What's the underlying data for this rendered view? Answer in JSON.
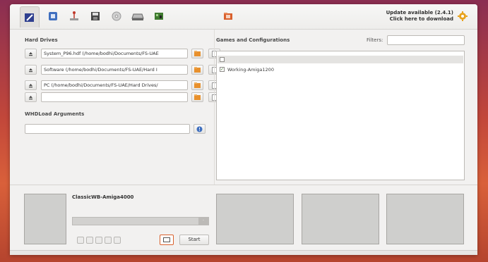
{
  "toolbar": {
    "icons": [
      {
        "name": "config-icon",
        "color": "#2f3f8f"
      },
      {
        "name": "chip-icon",
        "color": "#3f6fbf"
      },
      {
        "name": "joystick-icon",
        "color": "#c0392b"
      },
      {
        "name": "floppy-icon",
        "color": "#444444"
      },
      {
        "name": "cdrom-icon",
        "color": "#9a9a9a"
      },
      {
        "name": "harddrive-icon",
        "color": "#666666"
      },
      {
        "name": "board-icon",
        "color": "#3f7a2f"
      },
      {
        "name": "folder-tab-icon",
        "color": "#d9602c"
      }
    ],
    "update_line1": "Update available (2.4.1)",
    "update_line2": "Click here to download"
  },
  "hard_drives": {
    "title": "Hard Drives",
    "rows": [
      {
        "path": "System_P96.hdf (/home/bodhi/Documents/FS-UAE"
      },
      {
        "path": "Software (/home/bodhi/Documents/FS-UAE/Hard I"
      },
      {
        "path": "PC (/home/bodhi/Documents/FS-UAE/Hard Drives/"
      },
      {
        "path": ""
      }
    ]
  },
  "whdload": {
    "title": "WHDLoad Arguments",
    "value": ""
  },
  "games": {
    "title": "Games and Configurations",
    "filters_label": "Filters:",
    "filters_value": "",
    "list_items": [
      {
        "label": "Working-Amiga1200",
        "checked": true
      }
    ]
  },
  "launcher": {
    "config_name": "ClassicWB-Amiga4000",
    "start_label": "Start"
  },
  "colors": {
    "accent": "#d9602c",
    "panel": "#f2f1f0",
    "preview": "#cfcfcd"
  }
}
